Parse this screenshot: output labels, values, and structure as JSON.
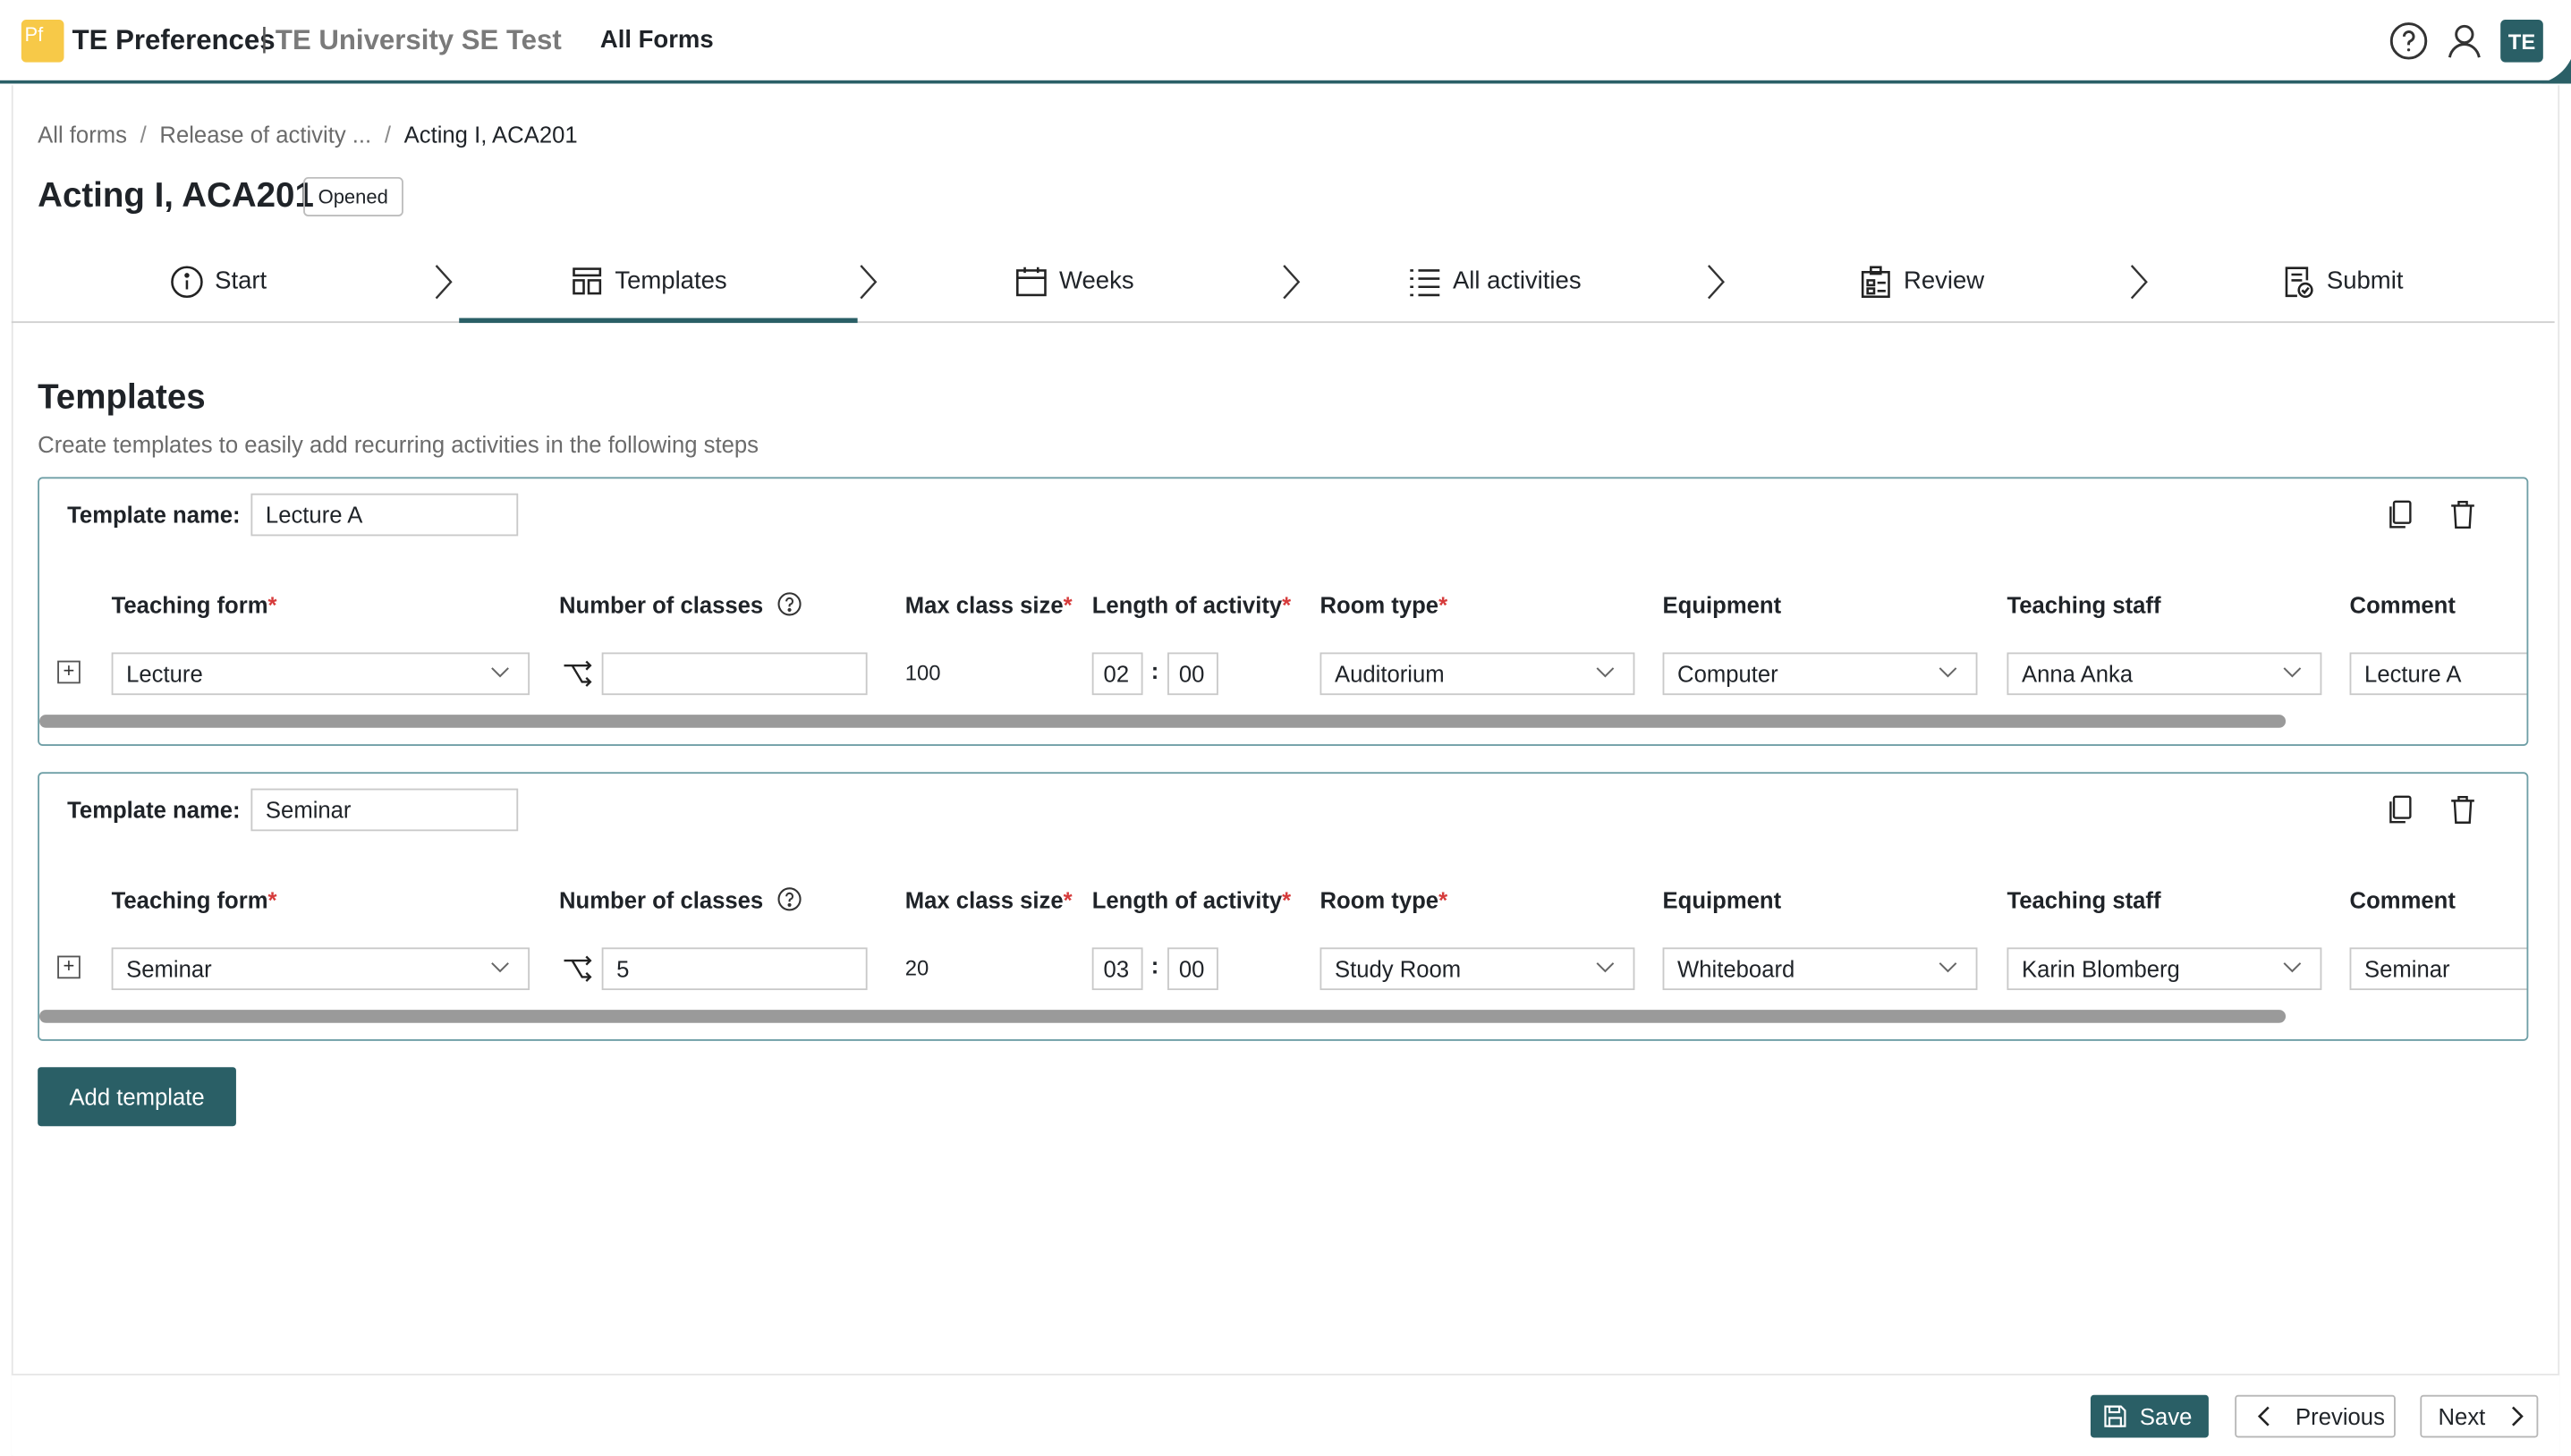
{
  "header": {
    "logo_text": "Pf",
    "app_title": "TE Preferences",
    "separator": "|",
    "org_name": "TE University SE Test",
    "nav_all_forms": "All Forms",
    "avatar_initials": "TE",
    "accent_color": "#2a5f66"
  },
  "breadcrumb": {
    "items": [
      "All forms",
      "Release of activity ...",
      "Acting I, ACA201"
    ],
    "separator": "/"
  },
  "page": {
    "title": "Acting I, ACA201",
    "status": "Opened"
  },
  "steps": [
    {
      "label": "Start",
      "icon": "info-icon"
    },
    {
      "label": "Templates",
      "icon": "templates-icon",
      "active": true
    },
    {
      "label": "Weeks",
      "icon": "calendar-icon"
    },
    {
      "label": "All activities",
      "icon": "list-icon"
    },
    {
      "label": "Review",
      "icon": "review-icon"
    },
    {
      "label": "Submit",
      "icon": "submit-icon"
    }
  ],
  "section": {
    "title": "Templates",
    "subtitle": "Create templates to easily add recurring activities in the following steps"
  },
  "columns": {
    "template_name": "Template name:",
    "teaching_form": "Teaching form",
    "number_of_classes": "Number of classes",
    "max_class_size": "Max class size",
    "length_of_activity": "Length of activity",
    "room_type": "Room type",
    "equipment": "Equipment",
    "teaching_staff": "Teaching staff",
    "comment": "Comment",
    "required_mark": "*",
    "colon": ":"
  },
  "templates": [
    {
      "name": "Lecture A",
      "teaching_form": "Lecture",
      "number_of_classes": "",
      "max_class_size": "100",
      "length_hours": "02",
      "length_minutes": "00",
      "room_type": "Auditorium",
      "equipment": "Computer",
      "teaching_staff": "Anna Anka",
      "comment": "Lecture A"
    },
    {
      "name": "Seminar",
      "teaching_form": "Seminar",
      "number_of_classes": "5",
      "max_class_size": "20",
      "length_hours": "03",
      "length_minutes": "00",
      "room_type": "Study Room",
      "equipment": "Whiteboard",
      "teaching_staff": "Karin Blomberg",
      "comment": "Seminar"
    }
  ],
  "actions": {
    "add_template": "Add template",
    "save": "Save",
    "previous": "Previous",
    "next": "Next"
  }
}
